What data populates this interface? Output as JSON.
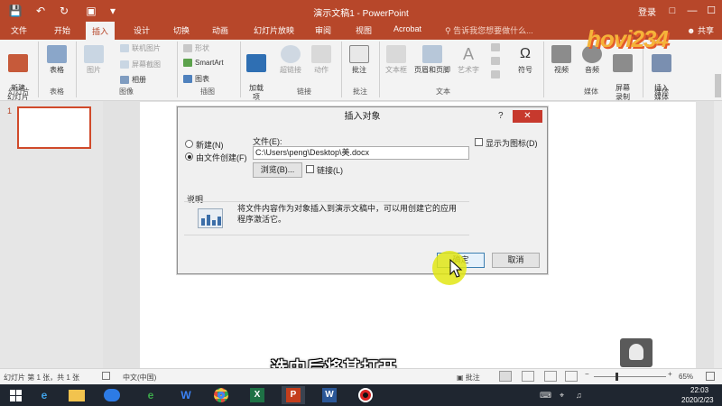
{
  "app": {
    "window_title": "演示文稿1 - PowerPoint",
    "login_label": "登录",
    "share_label": "共享",
    "tell_me_placeholder": "告诉我您想要做什么..."
  },
  "tabs": [
    "文件",
    "开始",
    "插入",
    "设计",
    "切换",
    "动画",
    "幻灯片放映",
    "审阅",
    "视图",
    "Acrobat"
  ],
  "active_tab": "插入",
  "ribbon": {
    "new_slide": "新建\n幻灯片",
    "table": "表格",
    "pictures": "图片",
    "online_pictures": "联机图片",
    "screenshot": "屏幕截图",
    "album": "相册",
    "shapes": "形状",
    "smartart": "SmartArt",
    "chart": "图表",
    "addins": "加载\n项",
    "hyperlink": "超链接",
    "action": "动作",
    "comment": "批注",
    "textbox": "文本框",
    "header_footer": "页眉和页脚",
    "wordart": "艺术字",
    "symbol": "符号",
    "video": "视频",
    "audio": "音频",
    "screen_record": "屏幕\n录制",
    "insert_media": "插入\n媒体",
    "groups": {
      "slides": "幻灯片",
      "tables": "表格",
      "images": "图像",
      "illustrations": "插图",
      "links": "链接",
      "comments": "批注",
      "text": "文本",
      "media": "媒体",
      "media2": "媒体"
    }
  },
  "thumbnail": {
    "number": "1"
  },
  "dialog": {
    "title": "插入对象",
    "help": "?",
    "close": "✕",
    "option_new": "新建(N)",
    "option_from_file": "由文件创建(F)",
    "file_label": "文件(E):",
    "file_path": "C:\\Users\\peng\\Desktop\\美.docx",
    "browse": "浏览(B)...",
    "link": "链接(L)",
    "display_as_icon": "显示为图标(D)",
    "description_label": "说明",
    "description_text": "将文件内容作为对象插入到演示文稿中，可以用创建它的应用程序激活它。",
    "ok": "确定",
    "cancel": "取消"
  },
  "subtitle": "选中后将其打开",
  "statusbar": {
    "slide_info": "幻灯片 第 1 张，共 1 张",
    "language": "中文(中国)",
    "comments": "批注",
    "zoom": "65%"
  },
  "taskbar": {
    "time": "22:03",
    "date": "2020/2/23"
  },
  "watermark": "hovi234",
  "colors": {
    "accent": "#b7472a",
    "close_red": "#c7392d",
    "highlight": "#e2e614"
  }
}
